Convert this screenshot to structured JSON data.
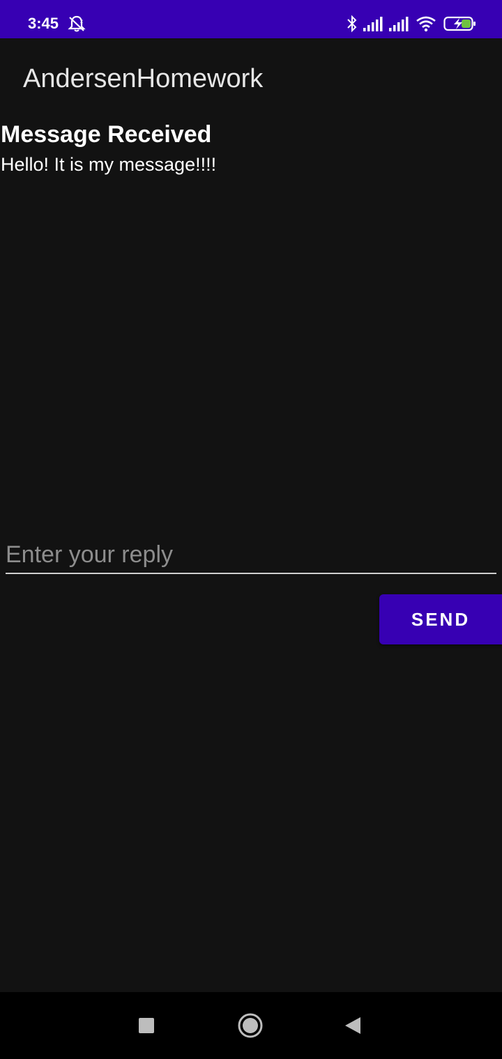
{
  "status_bar": {
    "time": "3:45",
    "icons": [
      "alarm-off-icon",
      "bluetooth-icon",
      "signal-icon",
      "signal-icon",
      "wifi-icon",
      "battery-charging-icon"
    ],
    "color": "#3700b3"
  },
  "app_bar": {
    "title": "AndersenHomework"
  },
  "message": {
    "heading": "Message Received",
    "text": "Hello! It is my message!!!!"
  },
  "reply": {
    "placeholder": "Enter your reply",
    "value": ""
  },
  "send_button": {
    "label": "SEND",
    "color": "#3700b3"
  },
  "nav_bar": {
    "icons": [
      "recents-icon",
      "home-icon",
      "back-icon"
    ]
  }
}
